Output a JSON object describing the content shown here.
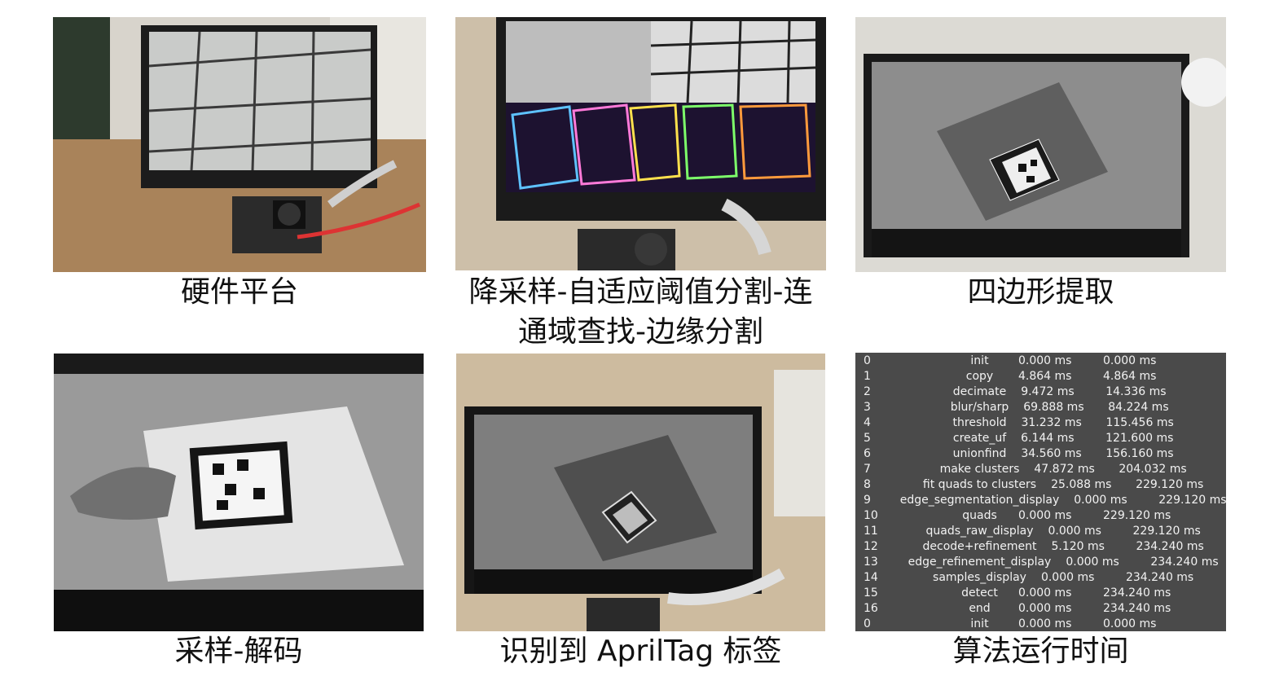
{
  "panels": [
    {
      "caption": "硬件平台"
    },
    {
      "caption_line1": "降采样-自适应阈值分割-连",
      "caption_line2": "通域查找-边缘分割"
    },
    {
      "caption": "四边形提取"
    },
    {
      "caption": "采样-解码"
    },
    {
      "caption": "识别到 AprilTag 标签"
    },
    {
      "caption": "算法运行时间"
    }
  ],
  "timing_table": [
    {
      "idx": "0",
      "name": "init",
      "t1": "0.000 ms",
      "t2": "0.000 ms"
    },
    {
      "idx": "1",
      "name": "copy",
      "t1": "4.864 ms",
      "t2": "4.864 ms"
    },
    {
      "idx": "2",
      "name": "decimate",
      "t1": "9.472 ms",
      "t2": "14.336 ms"
    },
    {
      "idx": "3",
      "name": "blur/sharp",
      "t1": "69.888 ms",
      "t2": "84.224 ms"
    },
    {
      "idx": "4",
      "name": "threshold",
      "t1": "31.232 ms",
      "t2": "115.456 ms"
    },
    {
      "idx": "5",
      "name": "create_uf",
      "t1": "6.144 ms",
      "t2": "121.600 ms"
    },
    {
      "idx": "6",
      "name": "unionfind",
      "t1": "34.560 ms",
      "t2": "156.160 ms"
    },
    {
      "idx": "7",
      "name": "make clusters",
      "t1": "47.872 ms",
      "t2": "204.032 ms"
    },
    {
      "idx": "8",
      "name": "fit quads to clusters",
      "t1": "25.088 ms",
      "t2": "229.120 ms"
    },
    {
      "idx": "9",
      "name": "edge_segmentation_display",
      "t1": "0.000 ms",
      "t2": "229.120 ms"
    },
    {
      "idx": "10",
      "name": "quads",
      "t1": "0.000 ms",
      "t2": "229.120 ms"
    },
    {
      "idx": "11",
      "name": "quads_raw_display",
      "t1": "0.000 ms",
      "t2": "229.120 ms"
    },
    {
      "idx": "12",
      "name": "decode+refinement",
      "t1": "5.120 ms",
      "t2": "234.240 ms"
    },
    {
      "idx": "13",
      "name": "edge_refinement_display",
      "t1": "0.000 ms",
      "t2": "234.240 ms"
    },
    {
      "idx": "14",
      "name": "samples_display",
      "t1": "0.000 ms",
      "t2": "234.240 ms"
    },
    {
      "idx": "15",
      "name": "detect",
      "t1": "0.000 ms",
      "t2": "234.240 ms"
    },
    {
      "idx": "16",
      "name": "end",
      "t1": "0.000 ms",
      "t2": "234.240 ms"
    },
    {
      "idx": "0",
      "name": "init",
      "t1": "0.000 ms",
      "t2": "0.000 ms"
    }
  ]
}
